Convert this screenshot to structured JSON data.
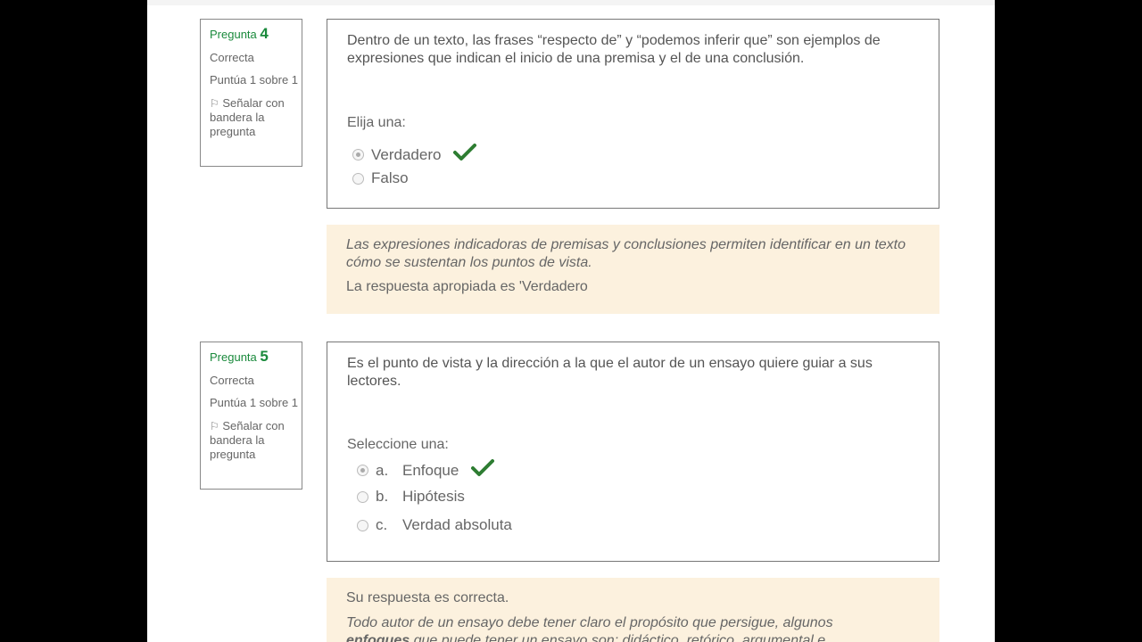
{
  "q4": {
    "label": "Pregunta",
    "number": "4",
    "state": "Correcta",
    "grade": "Puntúa 1 sobre 1",
    "flag": "Señalar con bandera la pregunta",
    "text": "Dentro de un texto, las frases “respecto de” y “podemos inferir que” son ejemplos de expresiones que indican el inicio de una premisa y el de una conclusión.",
    "prompt": "Elija una:",
    "options": [
      "Verdadero",
      "Falso"
    ],
    "feedback_general": "Las expresiones indicadoras de premisas y conclusiones permiten identificar en un texto cómo se sustentan los puntos de vista.",
    "feedback_right": "La respuesta apropiada es 'Verdadero"
  },
  "q5": {
    "label": "Pregunta",
    "number": "5",
    "state": "Correcta",
    "grade": "Puntúa 1 sobre 1",
    "flag": "Señalar con bandera la pregunta",
    "text": "Es el punto de vista y la dirección a la que el autor de un ensayo quiere guiar a sus lectores.",
    "prompt": "Seleccione una:",
    "options": [
      {
        "letter": "a.",
        "text": "Enfoque"
      },
      {
        "letter": "b.",
        "text": "Hipótesis"
      },
      {
        "letter": "c.",
        "text": "Verdad absoluta"
      }
    ],
    "feedback_status": "Su respuesta es correcta.",
    "feedback_general_1": "Todo autor de un ensayo debe tener claro el propósito que persigue, algunos",
    "feedback_general_bold": "enfoques",
    "feedback_general_2": " que puede tener un ensayo son: didáctico, retórico, argumental e"
  },
  "colors": {
    "correct": "#2e7d32",
    "feedback_bg": "#fcf1de",
    "question_number": "#1a8a3c"
  },
  "icons": {
    "flag": "flag-icon",
    "check": "check-icon"
  }
}
